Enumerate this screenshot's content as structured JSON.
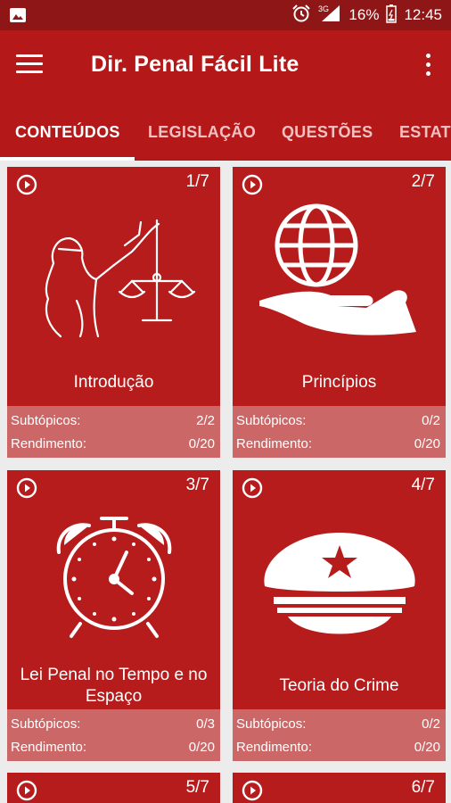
{
  "status_bar": {
    "battery": "16%",
    "time": "12:45",
    "network": "3G"
  },
  "app_bar": {
    "title": "Dir. Penal Fácil Lite"
  },
  "tabs": [
    {
      "label": "CONTEÚDOS"
    },
    {
      "label": "LEGISLAÇÃO"
    },
    {
      "label": "QUESTÕES"
    },
    {
      "label": "ESTAT"
    }
  ],
  "cards": [
    {
      "index": "1/7",
      "title": "Introdução",
      "icon": "justice-icon",
      "subtopics_label": "Subtópicos:",
      "subtopics": "2/2",
      "performance_label": "Rendimento:",
      "performance": "0/20"
    },
    {
      "index": "2/7",
      "title": "Princípios",
      "icon": "globe-hand-icon",
      "subtopics_label": "Subtópicos:",
      "subtopics": "0/2",
      "performance_label": "Rendimento:",
      "performance": "0/20"
    },
    {
      "index": "3/7",
      "title": "Lei Penal no Tempo e no Espaço",
      "icon": "alarm-clock-icon",
      "subtopics_label": "Subtópicos:",
      "subtopics": "0/3",
      "performance_label": "Rendimento:",
      "performance": "0/20"
    },
    {
      "index": "4/7",
      "title": "Teoria do Crime",
      "icon": "police-cap-icon",
      "subtopics_label": "Subtópicos:",
      "subtopics": "0/2",
      "performance_label": "Rendimento:",
      "performance": "0/20"
    },
    {
      "index": "5/7"
    },
    {
      "index": "6/7"
    }
  ],
  "colors": {
    "primary": "#b41818",
    "status_bar": "#8e1616",
    "card": "#b71c1c",
    "card_footer": "#cc6767"
  }
}
